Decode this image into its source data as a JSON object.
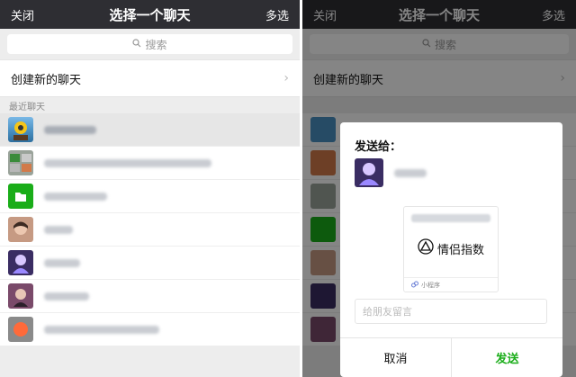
{
  "left": {
    "header": {
      "close_label": "关闭",
      "title": "选择一个聊天",
      "multi_label": "多选"
    },
    "search": {
      "placeholder": "搜索"
    },
    "new_chat_label": "创建新的聊天",
    "recent_label": "最近聊天",
    "chats": [
      {
        "avatar_color": "#4a90c2",
        "accent": "#f5c518"
      },
      {
        "avatar_color": "#9aa39a",
        "accent": "#3a8b3a"
      },
      {
        "avatar_color": "#1aad19",
        "accent": "#ffffff"
      },
      {
        "avatar_color": "#c69a83",
        "accent": "#3d2a22"
      },
      {
        "avatar_color": "#3a2d63",
        "accent": "#9a88ff"
      },
      {
        "avatar_color": "#7a4a6a",
        "accent": "#e8c6b5"
      },
      {
        "avatar_color": "#8a8a8a",
        "accent": "#ff6a3a"
      }
    ]
  },
  "right": {
    "header": {
      "close_label": "关闭",
      "title": "选择一个聊天",
      "multi_label": "多选"
    },
    "search": {
      "placeholder": "搜索"
    },
    "new_chat_label": "创建新的聊天",
    "dialog": {
      "heading": "发送给：",
      "card_brand": "情侣指数",
      "card_footer": "小程序",
      "note_placeholder": "给朋友留言",
      "cancel_label": "取消",
      "send_label": "发送"
    }
  },
  "colors": {
    "titlebar": "#2e2e33",
    "send_green": "#1aad19"
  }
}
